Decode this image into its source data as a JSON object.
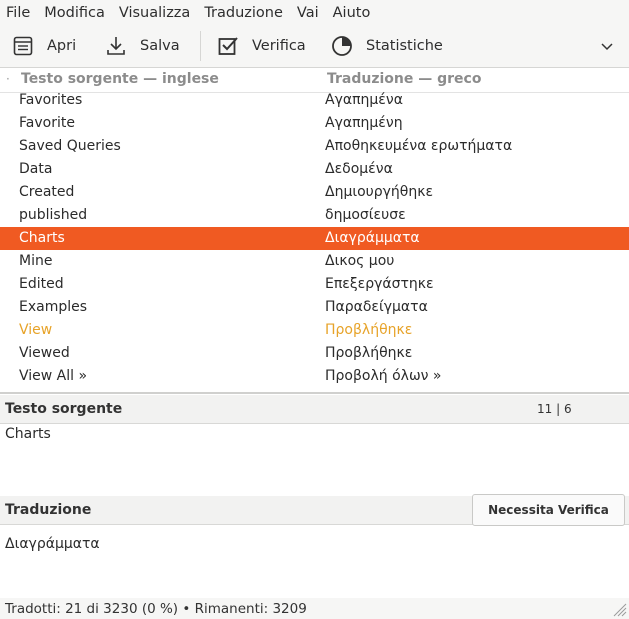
{
  "menu": [
    "File",
    "Modifica",
    "Visualizza",
    "Traduzione",
    "Vai",
    "Aiuto"
  ],
  "toolbar": {
    "open_label": "Apri",
    "save_label": "Salva",
    "check_label": "Verifica",
    "stats_label": "Statistiche"
  },
  "list": {
    "source_header": "Testo sorgente — inglese",
    "target_header": "Traduzione — greco",
    "rows": [
      {
        "source": "Favorites",
        "target": "Αγαπημένα"
      },
      {
        "source": "Favorite",
        "target": "Αγαπημένη"
      },
      {
        "source": "Saved Queries",
        "target": "Αποθηκευμένα ερωτήματα"
      },
      {
        "source": "Data",
        "target": "Δεδομένα"
      },
      {
        "source": "Created",
        "target": "Δημιουργήθηκε"
      },
      {
        "source": "published",
        "target": "δημοσίευσε"
      },
      {
        "source": "Charts",
        "target": "Διαγράμματα",
        "state": "selected"
      },
      {
        "source": "Mine",
        "target": "Δικος μου"
      },
      {
        "source": "Edited",
        "target": "Επεξεργάστηκε"
      },
      {
        "source": "Examples",
        "target": "Παραδείγματα"
      },
      {
        "source": "View",
        "target": "Προβλήθηκε",
        "state": "fuzzy"
      },
      {
        "source": "Viewed",
        "target": "Προβλήθηκε"
      },
      {
        "source": "View All »",
        "target": "Προβολή όλων »"
      }
    ]
  },
  "source_panel": {
    "title": "Testo sorgente",
    "counter": "11 | 6",
    "text": "Charts"
  },
  "translation_panel": {
    "title": "Traduzione",
    "needs_review_label": "Necessita Verifica",
    "text": "Διαγράμματα"
  },
  "status": {
    "text": "Tradotti: 21 di 3230 (0 %) • Rimanenti: 3209"
  },
  "colors": {
    "selected_row": "#f05a22",
    "fuzzy_text": "#e7a329"
  }
}
